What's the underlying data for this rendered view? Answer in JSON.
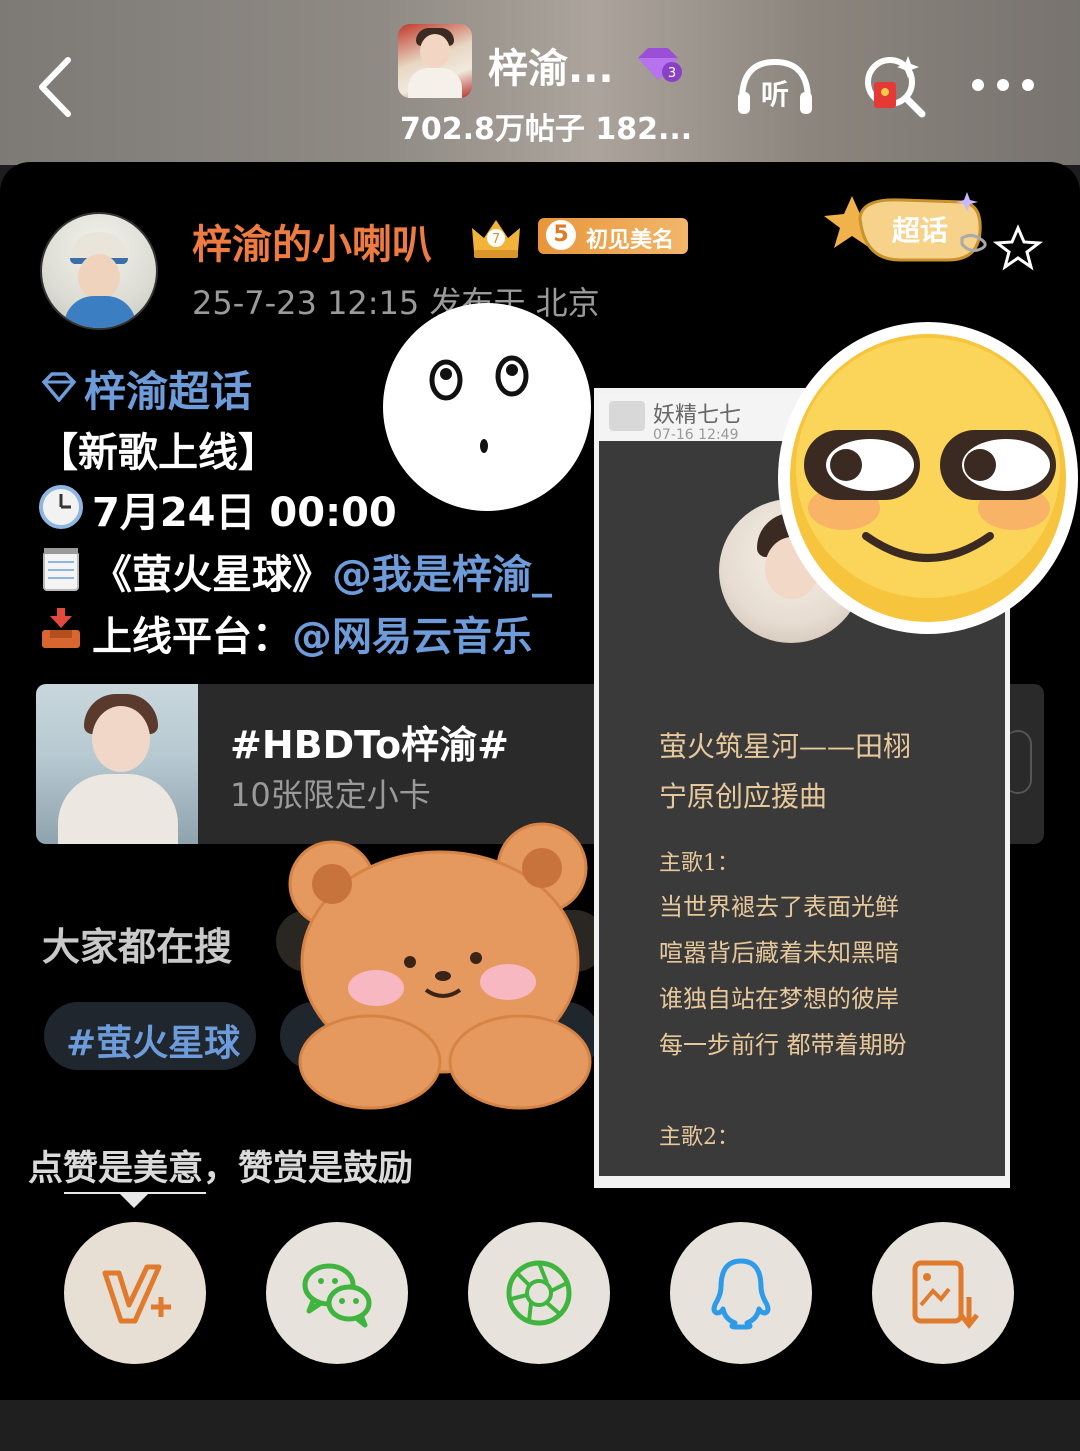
{
  "header": {
    "title": "梓渝...",
    "stats": "702.8万帖子 182...",
    "badge_level": "3",
    "listen_label": "听"
  },
  "post": {
    "username": "梓渝的小喇叭",
    "crown_level": "7",
    "fan_level": "5",
    "fan_badge": "初见美名",
    "chaohua_label": "超话",
    "timeline": "25-7-23 12:15  发布于 北京",
    "topic": "梓渝超话",
    "line1": "【新歌上线】",
    "line2": "7月24日 00:00",
    "line3_song": "《萤火星球》",
    "line3_mention": "@我是梓渝_",
    "line4_label": "上线平台：",
    "line4_mention": "@网易云音乐"
  },
  "card": {
    "title": "#HBDTo梓渝#",
    "subtitle": "10张限定小卡"
  },
  "search": {
    "label": "大家都在搜",
    "tags": [
      "#萤火星球"
    ]
  },
  "praise": {
    "text": "点赞是美意，赞赏是鼓励"
  },
  "share": {
    "icons": [
      "v-plus-icon",
      "wechat-icon",
      "moments-icon",
      "qq-icon",
      "save-image-icon"
    ]
  },
  "screenshot": {
    "author": "妖精七七",
    "date": "07-16 12:49",
    "title_line1": "萤火筑星河——田栩",
    "title_line2": "宁原创应援曲",
    "section1": "主歌1：",
    "lyrics": [
      "当世界褪去了表面光鲜",
      "喧嚣背后藏着未知黑暗",
      "谁独自站在梦想的彼岸",
      "每一步前行 都带着期盼"
    ],
    "section2": "主歌2："
  },
  "colors": {
    "username": "#ee7b3f",
    "link": "#6e9bd9",
    "lyric": "#e7c89b"
  }
}
